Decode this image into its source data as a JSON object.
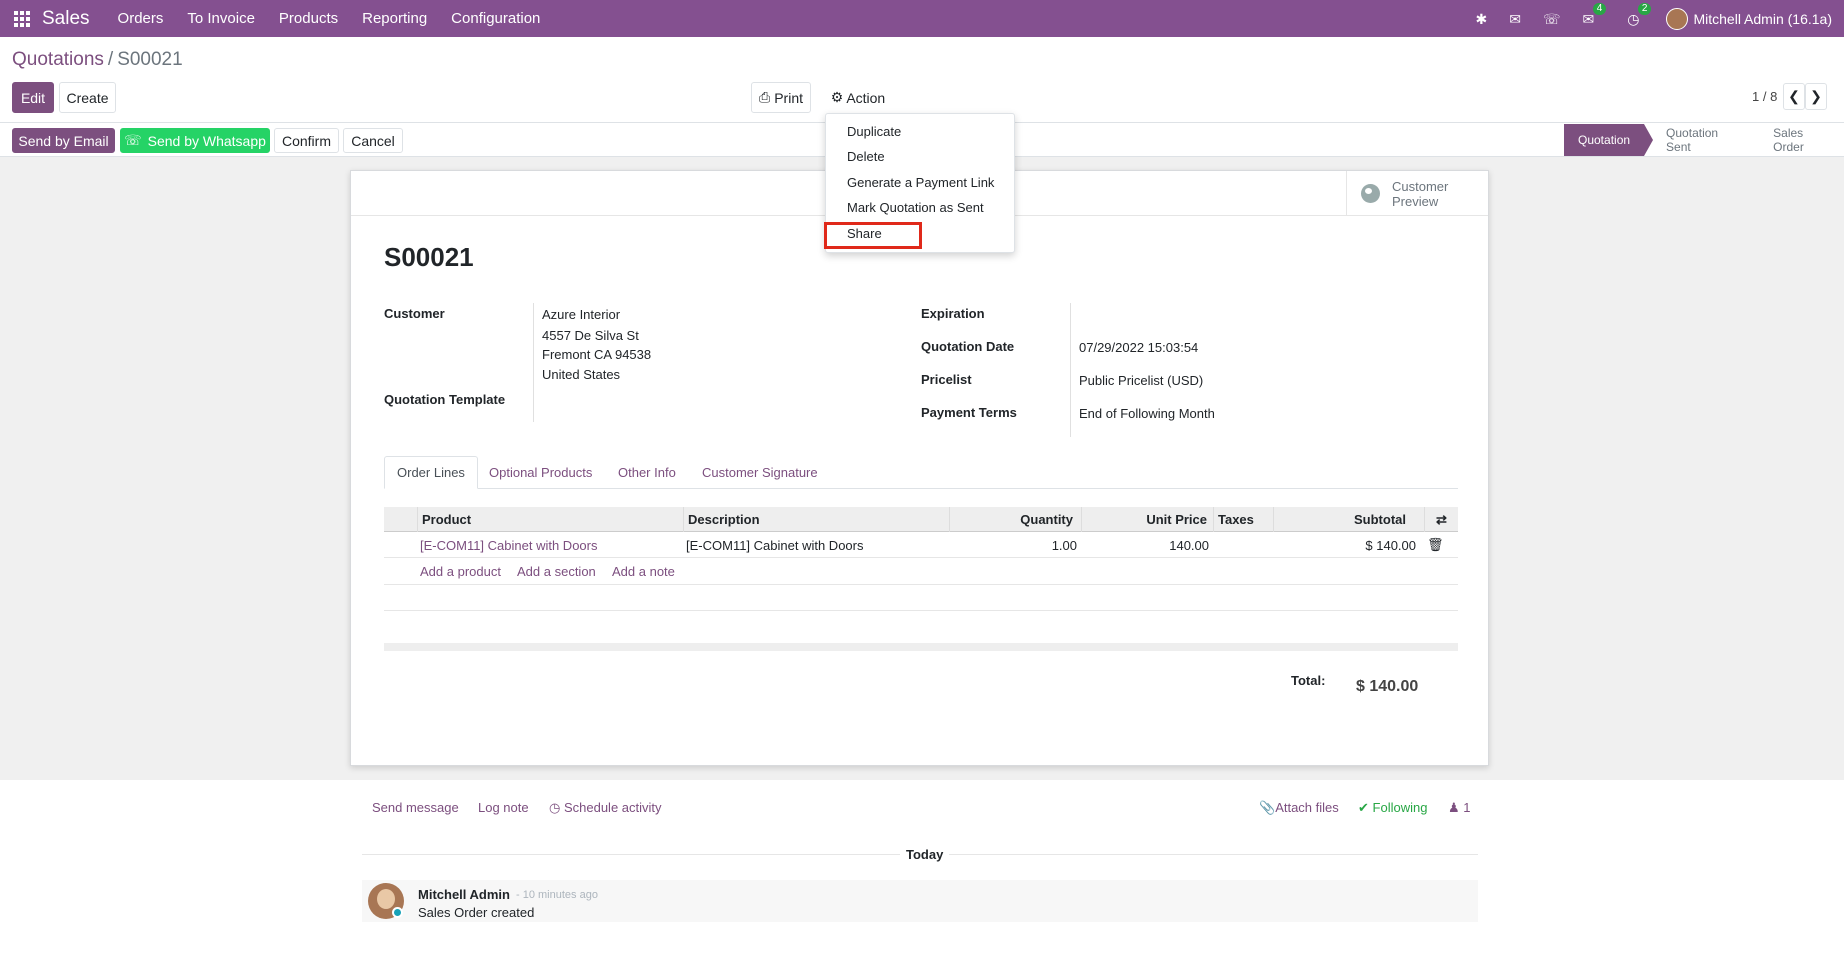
{
  "navbar": {
    "app_name": "Sales",
    "menu": [
      "Orders",
      "To Invoice",
      "Products",
      "Reporting",
      "Configuration"
    ],
    "messages_badge": "4",
    "activity_badge": "2",
    "user": "Mitchell Admin (16.1a)"
  },
  "breadcrumb": {
    "parent": "Quotations",
    "sep": "/",
    "current": "S00021"
  },
  "toolbar": {
    "edit": "Edit",
    "create": "Create",
    "print": "Print",
    "action": "Action"
  },
  "pager": {
    "text": "1 / 8"
  },
  "actions": {
    "send_email": "Send by Email",
    "send_whatsapp": "Send by Whatsapp",
    "confirm": "Confirm",
    "cancel": "Cancel"
  },
  "status": {
    "stages": [
      "Quotation",
      "Quotation Sent",
      "Sales Order"
    ],
    "active": "Quotation"
  },
  "action_menu": {
    "items": [
      "Duplicate",
      "Delete",
      "Generate a Payment Link",
      "Mark Quotation as Sent",
      "Share"
    ],
    "highlighted": "Share"
  },
  "sheet": {
    "preview_line1": "Customer",
    "preview_line2": "Preview",
    "name": "S00021",
    "labels": {
      "customer": "Customer",
      "template": "Quotation Template",
      "expiration": "Expiration",
      "date": "Quotation Date",
      "pricelist": "Pricelist",
      "terms": "Payment Terms"
    },
    "customer": {
      "name": "Azure Interior",
      "street": "4557 De Silva St",
      "city": "Fremont CA 94538",
      "country": "United States"
    },
    "quotation_date": "07/29/2022 15:03:54",
    "pricelist": "Public Pricelist (USD)",
    "payment_terms": "End of Following Month",
    "tabs": [
      "Order Lines",
      "Optional Products",
      "Other Info",
      "Customer Signature"
    ],
    "table": {
      "headers": [
        "Product",
        "Description",
        "Quantity",
        "Unit Price",
        "Taxes",
        "Subtotal"
      ],
      "rows": [
        {
          "product": "[E-COM11] Cabinet with Doors",
          "description": "[E-COM11] Cabinet with Doors",
          "quantity": "1.00",
          "unit_price": "140.00",
          "taxes": "",
          "subtotal": "$ 140.00"
        }
      ],
      "add_product": "Add a product",
      "add_section": "Add a section",
      "add_note": "Add a note"
    },
    "total_label": "Total:",
    "total_value": "$ 140.00"
  },
  "chatter": {
    "send_message": "Send message",
    "log_note": "Log note",
    "schedule": "Schedule activity",
    "attach": "Attach files",
    "following": "Following",
    "followers": "1",
    "today": "Today",
    "message": {
      "author": "Mitchell Admin",
      "date": "- 10 minutes ago",
      "body": "Sales Order created"
    }
  },
  "colors": {
    "brand": "#845090",
    "link": "#7c4f7f",
    "whatsapp": "#25d366",
    "highlight": "#e0291a"
  }
}
